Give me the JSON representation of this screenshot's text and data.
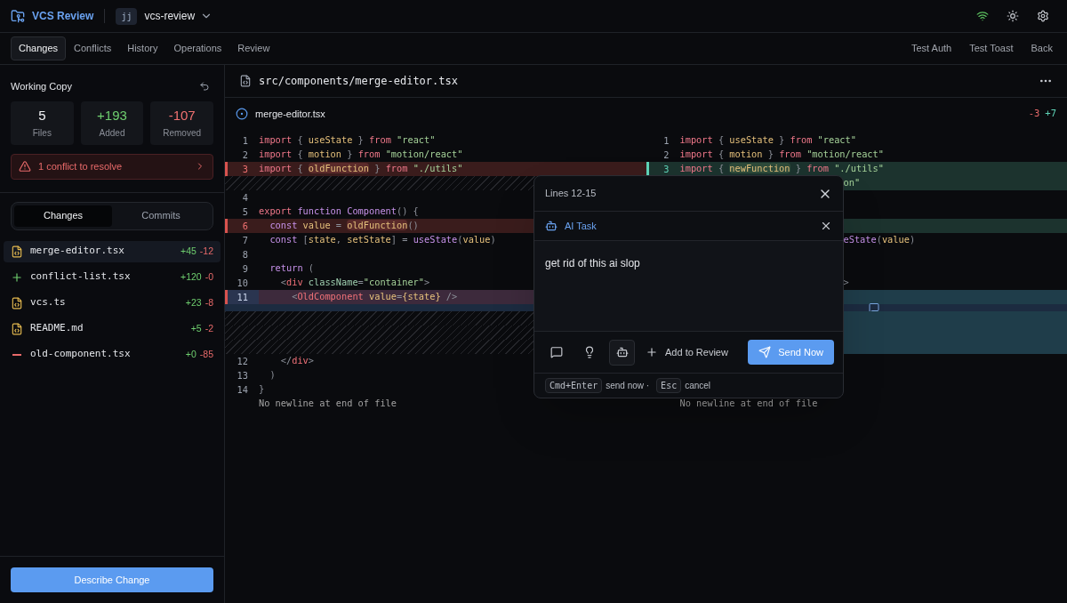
{
  "app": {
    "title": "VCS Review",
    "vcs_badge": "jj",
    "repo": "vcs-review"
  },
  "tabs": [
    {
      "label": "Changes",
      "selected": true
    },
    {
      "label": "Conflicts",
      "selected": false
    },
    {
      "label": "History",
      "selected": false
    },
    {
      "label": "Operations",
      "selected": false
    },
    {
      "label": "Review",
      "selected": false
    }
  ],
  "nav_links": [
    "Test Auth",
    "Test Toast",
    "Back"
  ],
  "sidebar": {
    "title": "Working Copy",
    "stats": [
      {
        "value": "5",
        "label": "Files",
        "kind": "neutral"
      },
      {
        "value": "+193",
        "label": "Added",
        "kind": "added"
      },
      {
        "value": "-107",
        "label": "Removed",
        "kind": "removed"
      }
    ],
    "alert": "1 conflict to resolve",
    "segments": [
      {
        "label": "Changes",
        "selected": true
      },
      {
        "label": "Commits",
        "selected": false
      }
    ],
    "files": [
      {
        "name": "merge-editor.tsx",
        "kind": "modified",
        "added": "+45",
        "removed": "-12",
        "selected": true
      },
      {
        "name": "conflict-list.tsx",
        "kind": "added",
        "added": "+120",
        "removed": "-0",
        "selected": false
      },
      {
        "name": "vcs.ts",
        "kind": "modified",
        "added": "+23",
        "removed": "-8",
        "selected": false
      },
      {
        "name": "README.md",
        "kind": "modified",
        "added": "+5",
        "removed": "-2",
        "selected": false
      },
      {
        "name": "old-component.tsx",
        "kind": "deleted",
        "added": "+0",
        "removed": "-85",
        "selected": false
      }
    ],
    "action": "Describe Change"
  },
  "editor": {
    "path": "src/components/merge-editor.tsx",
    "file": "merge-editor.tsx",
    "removed": "-3",
    "added": "+7",
    "left": [
      {
        "kind": "line",
        "number": "1",
        "removed": false,
        "added": false,
        "selected": false,
        "tokens": [
          {
            "text": "import",
            "kind": "kw"
          },
          {
            "text": " { ",
            "kind": "punct"
          },
          {
            "text": "useState",
            "kind": "name"
          },
          {
            "text": " } ",
            "kind": "punct"
          },
          {
            "text": "from",
            "kind": "kw"
          },
          {
            "text": " \"react\"",
            "kind": "str"
          }
        ]
      },
      {
        "kind": "line",
        "number": "2",
        "removed": false,
        "added": false,
        "selected": false,
        "tokens": [
          {
            "text": "import",
            "kind": "kw"
          },
          {
            "text": " { ",
            "kind": "punct"
          },
          {
            "text": "motion",
            "kind": "name"
          },
          {
            "text": " } ",
            "kind": "punct"
          },
          {
            "text": "from",
            "kind": "kw"
          },
          {
            "text": " \"motion/react\"",
            "kind": "str"
          }
        ]
      },
      {
        "kind": "line",
        "number": "3",
        "removed": true,
        "added": false,
        "selected": false,
        "tokens": [
          {
            "text": "import",
            "kind": "kw"
          },
          {
            "text": " { ",
            "kind": "punct"
          },
          {
            "text": "oldFunction",
            "kind": "highlight"
          },
          {
            "text": " } ",
            "kind": "punct"
          },
          {
            "text": "from",
            "kind": "kw"
          },
          {
            "text": " \"./utils\"",
            "kind": "str"
          }
        ]
      },
      {
        "kind": "filler"
      },
      {
        "kind": "line",
        "number": "4",
        "removed": false,
        "added": false,
        "selected": false
      },
      {
        "kind": "line",
        "number": "5",
        "removed": false,
        "added": false,
        "selected": false,
        "tokens": [
          {
            "text": "export",
            "kind": "kw"
          },
          {
            "text": " function ",
            "kind": "kw2"
          },
          {
            "text": "Component",
            "kind": "fn"
          },
          {
            "text": "() {",
            "kind": "punct"
          }
        ]
      },
      {
        "kind": "line",
        "number": "6",
        "removed": true,
        "added": false,
        "selected": false,
        "tokens": [
          {
            "text": "  const ",
            "kind": "kw2"
          },
          {
            "text": "value",
            "kind": "name"
          },
          {
            "text": " = ",
            "kind": "punct"
          },
          {
            "text": "oldFunction",
            "kind": "highlight"
          },
          {
            "text": "()",
            "kind": "punct"
          }
        ]
      },
      {
        "kind": "line",
        "number": "7",
        "removed": false,
        "added": false,
        "selected": false,
        "tokens": [
          {
            "text": "  const ",
            "kind": "kw2"
          },
          {
            "text": "[",
            "kind": "punct"
          },
          {
            "text": "state",
            "kind": "name"
          },
          {
            "text": ", ",
            "kind": "punct"
          },
          {
            "text": "setState",
            "kind": "name"
          },
          {
            "text": "] = ",
            "kind": "punct"
          },
          {
            "text": "useState",
            "kind": "fn"
          },
          {
            "text": "(",
            "kind": "punct"
          },
          {
            "text": "value",
            "kind": "name"
          },
          {
            "text": ")",
            "kind": "punct"
          }
        ]
      },
      {
        "kind": "line",
        "number": "8",
        "removed": false,
        "added": false,
        "selected": false
      },
      {
        "kind": "line",
        "number": "9",
        "removed": false,
        "added": false,
        "selected": false,
        "tokens": [
          {
            "text": "  return ",
            "kind": "kw2"
          },
          {
            "text": "(",
            "kind": "punct"
          }
        ]
      },
      {
        "kind": "line",
        "number": "10",
        "removed": false,
        "added": false,
        "selected": false,
        "tokens": [
          {
            "text": "    <",
            "kind": "punct"
          },
          {
            "text": "div",
            "kind": "tag"
          },
          {
            "text": " className",
            "kind": "attr"
          },
          {
            "text": "=",
            "kind": "punct"
          },
          {
            "text": "\"container\"",
            "kind": "str"
          },
          {
            "text": ">",
            "kind": "punct"
          }
        ]
      },
      {
        "kind": "line",
        "number": "11",
        "removed": true,
        "added": false,
        "selected": true,
        "tokens": [
          {
            "text": "      <",
            "kind": "punct"
          },
          {
            "text": "OldComponent",
            "kind": "tag"
          },
          {
            "text": " value",
            "kind": "name"
          },
          {
            "text": "=",
            "kind": "punct"
          },
          {
            "text": "{state}",
            "kind": "name"
          },
          {
            "text": " />",
            "kind": "punct"
          }
        ]
      },
      {
        "kind": "spacer",
        "removed": false,
        "added": false,
        "selected": true,
        "comment_marker": false
      },
      {
        "kind": "filler"
      },
      {
        "kind": "filler"
      },
      {
        "kind": "filler"
      },
      {
        "kind": "line",
        "number": "12",
        "removed": false,
        "added": false,
        "selected": false,
        "tokens": [
          {
            "text": "    </",
            "kind": "punct"
          },
          {
            "text": "div",
            "kind": "tag"
          },
          {
            "text": ">",
            "kind": "punct"
          }
        ]
      },
      {
        "kind": "line",
        "number": "13",
        "removed": false,
        "added": false,
        "selected": false,
        "tokens": [
          {
            "text": "  )",
            "kind": "punct"
          }
        ]
      },
      {
        "kind": "line",
        "number": "14",
        "removed": false,
        "added": false,
        "selected": false,
        "tokens": [
          {
            "text": "}",
            "kind": "punct"
          }
        ]
      },
      {
        "kind": "note",
        "text": "No newline at end of file"
      }
    ],
    "right": [
      {
        "kind": "line",
        "number": "1",
        "removed": false,
        "added": false,
        "selected": false,
        "tokens": [
          {
            "text": "import",
            "kind": "kw"
          },
          {
            "text": " { ",
            "kind": "punct"
          },
          {
            "text": "useState",
            "kind": "name"
          },
          {
            "text": " } ",
            "kind": "punct"
          },
          {
            "text": "from",
            "kind": "kw"
          },
          {
            "text": " \"react\"",
            "kind": "str"
          }
        ]
      },
      {
        "kind": "line",
        "number": "2",
        "removed": false,
        "added": false,
        "selected": false,
        "tokens": [
          {
            "text": "import",
            "kind": "kw"
          },
          {
            "text": " { ",
            "kind": "punct"
          },
          {
            "text": "motion",
            "kind": "name"
          },
          {
            "text": " } ",
            "kind": "punct"
          },
          {
            "text": "from",
            "kind": "kw"
          },
          {
            "text": " \"motion/react\"",
            "kind": "str"
          }
        ]
      },
      {
        "kind": "line",
        "number": "3",
        "removed": false,
        "added": true,
        "selected": false,
        "tokens": [
          {
            "text": "import",
            "kind": "kw"
          },
          {
            "text": " { ",
            "kind": "punct"
          },
          {
            "text": "newFunction",
            "kind": "highlight"
          },
          {
            "text": " } ",
            "kind": "punct"
          },
          {
            "text": "from",
            "kind": "kw"
          },
          {
            "text": " \"./utils\"",
            "kind": "str"
          }
        ]
      },
      {
        "kind": "partial",
        "removed": false,
        "added": true,
        "selected": false,
        "tokens": [
          {
            "text": "on\"",
            "kind": "str"
          }
        ]
      },
      {
        "kind": "spacer",
        "removed": false,
        "added": false,
        "selected": false,
        "comment_marker": false
      },
      {
        "kind": "spacer",
        "removed": false,
        "added": false,
        "selected": false,
        "comment_marker": false
      },
      {
        "kind": "spacer",
        "removed": false,
        "added": true,
        "selected": false,
        "comment_marker": false
      },
      {
        "kind": "partial",
        "removed": false,
        "added": false,
        "selected": false,
        "tokens": [
          {
            "text": "eState",
            "kind": "fn"
          },
          {
            "text": "(",
            "kind": "punct"
          },
          {
            "text": "value",
            "kind": "name"
          },
          {
            "text": ")",
            "kind": "punct"
          }
        ]
      },
      {
        "kind": "spacer",
        "removed": false,
        "added": false,
        "selected": false,
        "comment_marker": false
      },
      {
        "kind": "spacer",
        "removed": false,
        "added": false,
        "selected": false,
        "comment_marker": false
      },
      {
        "kind": "partial",
        "removed": false,
        "added": false,
        "selected": false,
        "tokens": [
          {
            "text": ">",
            "kind": "punct"
          }
        ]
      },
      {
        "kind": "spacer",
        "removed": false,
        "added": true,
        "selected": true,
        "comment_marker": false
      },
      {
        "kind": "spacer",
        "removed": false,
        "added": false,
        "selected": true,
        "comment_marker": true
      },
      {
        "kind": "spacer",
        "removed": false,
        "added": true,
        "selected": true,
        "comment_marker": false
      },
      {
        "kind": "spacer",
        "removed": false,
        "added": true,
        "selected": true,
        "comment_marker": false
      },
      {
        "kind": "spacer",
        "removed": false,
        "added": true,
        "selected": true,
        "comment_marker": false
      },
      {
        "kind": "spacer",
        "removed": false,
        "added": false,
        "selected": false,
        "comment_marker": false
      },
      {
        "kind": "spacer",
        "removed": false,
        "added": false,
        "selected": false,
        "comment_marker": false
      },
      {
        "kind": "spacer",
        "removed": false,
        "added": false,
        "selected": false,
        "comment_marker": false
      },
      {
        "kind": "note",
        "text": "No newline at end of file"
      }
    ]
  },
  "popup": {
    "title": "Lines 12-15",
    "task": "AI Task",
    "text": "get rid of this ai slop",
    "tools": [
      {
        "kind": "comment",
        "selected": false
      },
      {
        "kind": "idea",
        "selected": false
      },
      {
        "kind": "ai",
        "selected": true
      }
    ],
    "add_label": "Add to Review",
    "send_label": "Send Now",
    "hints": [
      {
        "key": "Cmd+Enter",
        "text": "send now ·"
      },
      {
        "key": "Esc",
        "text": "cancel"
      }
    ]
  }
}
